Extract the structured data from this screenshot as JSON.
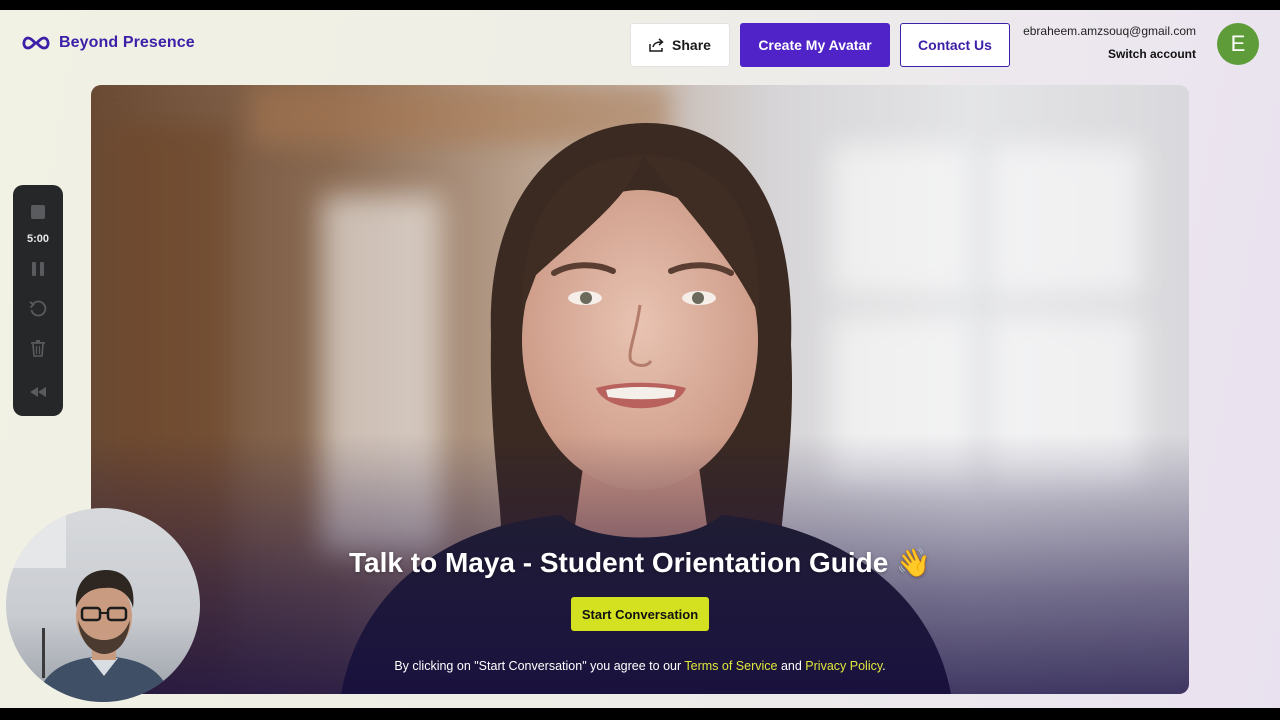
{
  "header": {
    "logo_text": "Beyond Presence",
    "share_label": "Share",
    "create_label": "Create My Avatar",
    "contact_label": "Contact Us",
    "account_email": "ebraheem.amzsouq@gmail.com",
    "switch_account": "Switch account",
    "avatar_initial": "E"
  },
  "toolbar": {
    "timer": "5:00",
    "icons": [
      "stop-icon",
      "pause-icon",
      "restart-icon",
      "trash-icon",
      "collapse-icon"
    ]
  },
  "video": {
    "title": "Talk to Maya - Student Orientation Guide 👋",
    "start_button": "Start Conversation",
    "legal_prefix": "By clicking on \"Start Conversation\" you agree to our ",
    "terms_label": "Terms of Service",
    "legal_and": " and ",
    "privacy_label": "Privacy Policy",
    "legal_suffix": "."
  },
  "colors": {
    "brand": "#3d1fa8",
    "primary_button": "#4f23c7",
    "accent_yellow": "#d4e121",
    "avatar_green": "#5e9c3a"
  }
}
